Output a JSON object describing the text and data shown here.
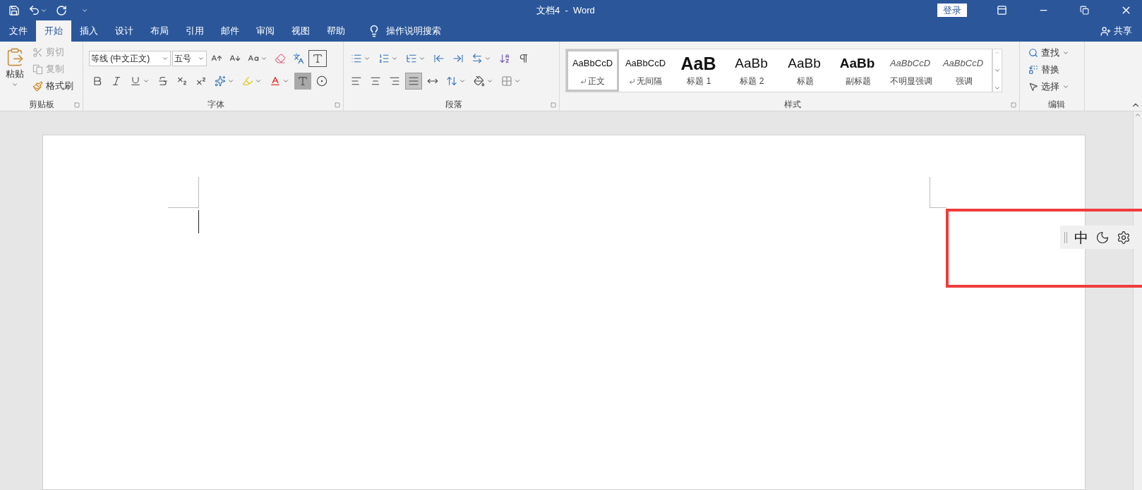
{
  "title_bar": {
    "title": "文档4  -  Word",
    "sign_in": "登录"
  },
  "tabs": [
    {
      "label": "文件",
      "selected": false
    },
    {
      "label": "开始",
      "selected": true
    },
    {
      "label": "插入",
      "selected": false
    },
    {
      "label": "设计",
      "selected": false
    },
    {
      "label": "布局",
      "selected": false
    },
    {
      "label": "引用",
      "selected": false
    },
    {
      "label": "邮件",
      "selected": false
    },
    {
      "label": "审阅",
      "selected": false
    },
    {
      "label": "视图",
      "selected": false
    },
    {
      "label": "帮助",
      "selected": false
    }
  ],
  "tell_me": "操作说明搜索",
  "share": "共享",
  "clipboard": {
    "paste": "粘贴",
    "cut": {
      "label": "剪切",
      "disabled": true
    },
    "copy": {
      "label": "复制",
      "disabled": true
    },
    "format_painter": {
      "label": "格式刷",
      "disabled": false
    },
    "label": "剪贴板"
  },
  "font": {
    "font_name": "等线 (中文正文)",
    "font_size": "五号",
    "label": "字体"
  },
  "paragraph": {
    "label": "段落",
    "alignment": [
      {
        "kind": "left",
        "selected": false
      },
      {
        "kind": "center",
        "selected": false
      },
      {
        "kind": "right",
        "selected": false
      },
      {
        "kind": "justify",
        "selected": true
      },
      {
        "kind": "distributed",
        "selected": false
      }
    ]
  },
  "styles": {
    "label": "样式",
    "items": [
      {
        "preview": "AaBbCcD",
        "label": "正文",
        "kind": "normal",
        "paragraph_mark": true,
        "selected": true
      },
      {
        "preview": "AaBbCcD",
        "label": "无间隔",
        "kind": "normal",
        "paragraph_mark": true,
        "selected": false
      },
      {
        "preview": "AaB",
        "label": "标题 1",
        "kind": "heading1",
        "paragraph_mark": false,
        "selected": false
      },
      {
        "preview": "AaBb",
        "label": "标题 2",
        "kind": "heading2",
        "paragraph_mark": false,
        "selected": false
      },
      {
        "preview": "AaBb",
        "label": "标题",
        "kind": "title",
        "paragraph_mark": false,
        "selected": false
      },
      {
        "preview": "AaBb",
        "label": "副标题",
        "kind": "subtitle",
        "paragraph_mark": false,
        "selected": false
      },
      {
        "preview": "AaBbCcD",
        "label": "不明显强调",
        "kind": "emphasis",
        "paragraph_mark": false,
        "selected": false
      },
      {
        "preview": "AaBbCcD",
        "label": "强调",
        "kind": "emphasis",
        "paragraph_mark": false,
        "selected": false
      }
    ]
  },
  "editing": {
    "find": "查找",
    "replace": "替换",
    "select": "选择",
    "label": "编辑"
  },
  "ime_toolbar": {
    "mode": "中"
  }
}
